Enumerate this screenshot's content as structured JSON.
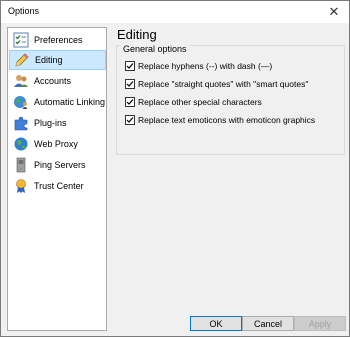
{
  "window": {
    "title": "Options",
    "close_glyph": "✕"
  },
  "sidebar": {
    "items": [
      {
        "label": "Preferences",
        "icon": "preferences-checklist-icon"
      },
      {
        "label": "Editing",
        "icon": "pencil-icon",
        "selected": true
      },
      {
        "label": "Accounts",
        "icon": "accounts-users-icon"
      },
      {
        "label": "Automatic Linking",
        "icon": "globe-person-icon"
      },
      {
        "label": "Plug-ins",
        "icon": "puzzle-piece-icon"
      },
      {
        "label": "Web Proxy",
        "icon": "globe-icon"
      },
      {
        "label": "Ping Servers",
        "icon": "server-icon"
      },
      {
        "label": "Trust Center",
        "icon": "trust-ribbon-icon"
      }
    ]
  },
  "main": {
    "title": "Editing",
    "group": {
      "legend": "General options",
      "options": [
        {
          "label": "Replace hyphens (--) with dash (—)",
          "checked": true
        },
        {
          "label": "Replace \"straight quotes\" with \"smart quotes\"",
          "checked": true
        },
        {
          "label": "Replace other special characters",
          "checked": true
        },
        {
          "label": "Replace text emoticons with emoticon graphics",
          "checked": true
        }
      ]
    }
  },
  "buttons": {
    "ok": "OK",
    "cancel": "Cancel",
    "apply": "Apply"
  },
  "colors": {
    "selection_bg": "#cce8ff",
    "selection_border": "#99d1ff",
    "dialog_bg": "#f0f0f0",
    "default_button_border": "#0078d7"
  }
}
